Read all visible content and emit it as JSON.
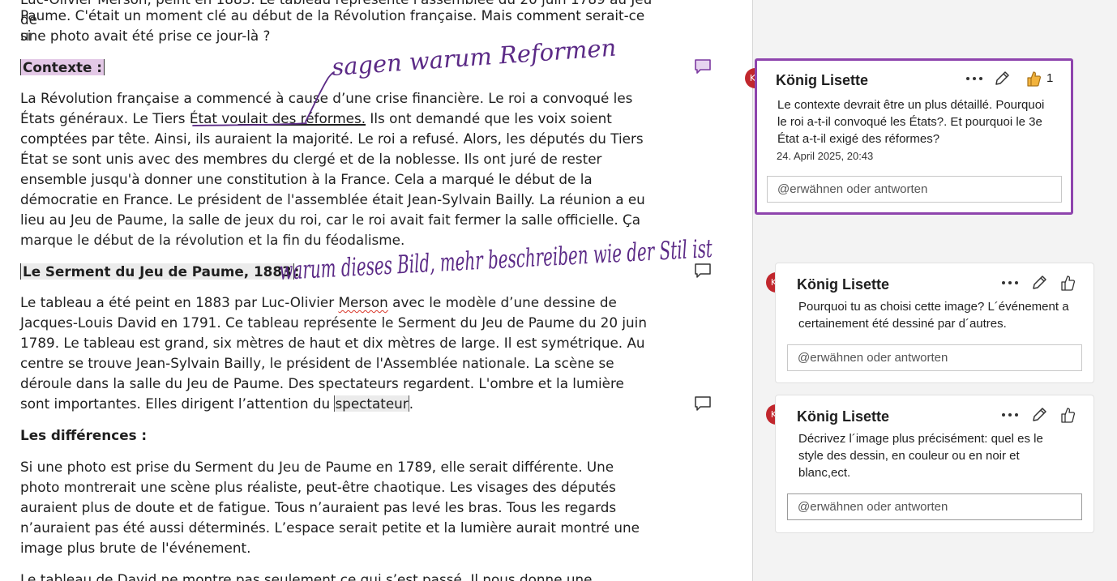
{
  "document": {
    "intro_partial_1": "Luc-Olivier Merson, peint en 1883. Le tableau représente l'assemblée du 20 juin 1789 au Jeu de",
    "intro_line_2": "Paume. C'était un moment clé au début de la Révolution française. Mais comment serait-ce si",
    "intro_line_3": "une photo avait été prise ce jour-là ?",
    "heading_contexte": "Contexte :",
    "contexte_p1": "La Révolution française a commencé à cause d’une crise financière. Le roi a convoqué les États généraux. Le Tiers État vo",
    "contexte_underlined": "ulait des réformes.",
    "contexte_p2": " Ils ont demandé que les voix soient comptées par tête. Ainsi, ils auraient la majorité. Le roi a refusé. Alors, les députés du Tiers État se sont unis avec des membres du clergé et de la noblesse. Ils ont juré de rester ensemble jusqu'à donner une constitution à la France. Cela a marqué le début de la démocratie en France. Le président de l'assemblée était Jean-Sylvain Bailly. La réunion a eu lieu au Jeu de Paume, la salle de jeux du roi, car le roi avait fait fermer la salle officielle. Ça marque le début de la révolution et la fin du féodalisme.",
    "heading_serment": "Le Serment du Jeu de Paume, 1883",
    "heading_serment_suffix": ":",
    "serment_p1": "Le tableau a été peint en 1883 par Luc-Olivier ",
    "serment_merson": "Merson",
    "serment_p2": " avec le modèle d’une dessine de Jacques-Louis David en 1791. Ce tableau représente le Serment du Jeu de Paume du 20 juin 1789. Le tableau est grand, six mètres de haut et dix mètres de large. Il est symétrique. Au centre se trouve Jean-Sylvain Bailly, le président de l'Assemblée nationale. La scène se déroule dans la salle du Jeu de Paume. Des spectateurs regardent. L'ombre et la lumière sont importantes. Elles dirigent l’attention du ",
    "serment_selected": "spectateur",
    "serment_end": ".",
    "heading_differences": "Les différences :",
    "differences_p": "Si une photo est prise du Serment du Jeu de Paume en 1789, elle serait différente. Une photo montrerait une scène plus réaliste, peut-être chaotique. Les visages des députés auraient plus de doute et de fatigue. Tous n’auraient pas levé les bras. Tous les regards n’auraient pas été aussi déterminés. L’espace serait petite et la lumière aurait montré une image plus brute de l'événement.",
    "last_line_partial": " Le tableau de David ne montre pas seulement ce qui s’est passé. Il nous donne une"
  },
  "ink_annotations": {
    "note_1": "sagen warum Reformen",
    "note_2": "warum dieses Bild, mehr beschreiben wie der Stil ist"
  },
  "comments": [
    {
      "initials": "KL",
      "author": "König Lisette",
      "text": "Le contexte devrait être un plus détaillé. Pourquoi le roi a-t-il convoqué les États?. Et pourquoi le 3e État a-t-il exigé des réformes?",
      "date": "24. April 2025, 20:43",
      "likes": "1",
      "reply_placeholder": "@erwähnen oder antworten"
    },
    {
      "initials": "KL",
      "author": "König Lisette",
      "text": "Pourquoi tu as choisi cette image? L´événement a certainement été dessiné par d´autres.",
      "reply_placeholder": "@erwähnen oder antworten"
    },
    {
      "initials": "KL",
      "author": "König Lisette",
      "text": "Décrivez l´image plus précisément: quel es le style des dessin, en couleur ou en noir et blanc,ect.",
      "reply_placeholder": "@erwähnen oder antworten"
    }
  ],
  "colors": {
    "active_comment_border": "#8e44ad",
    "avatar": "#c1272d",
    "ink": "#5b2a86",
    "heading_highlight": "#e3c8e6",
    "like_fill": "#f2b33d"
  }
}
